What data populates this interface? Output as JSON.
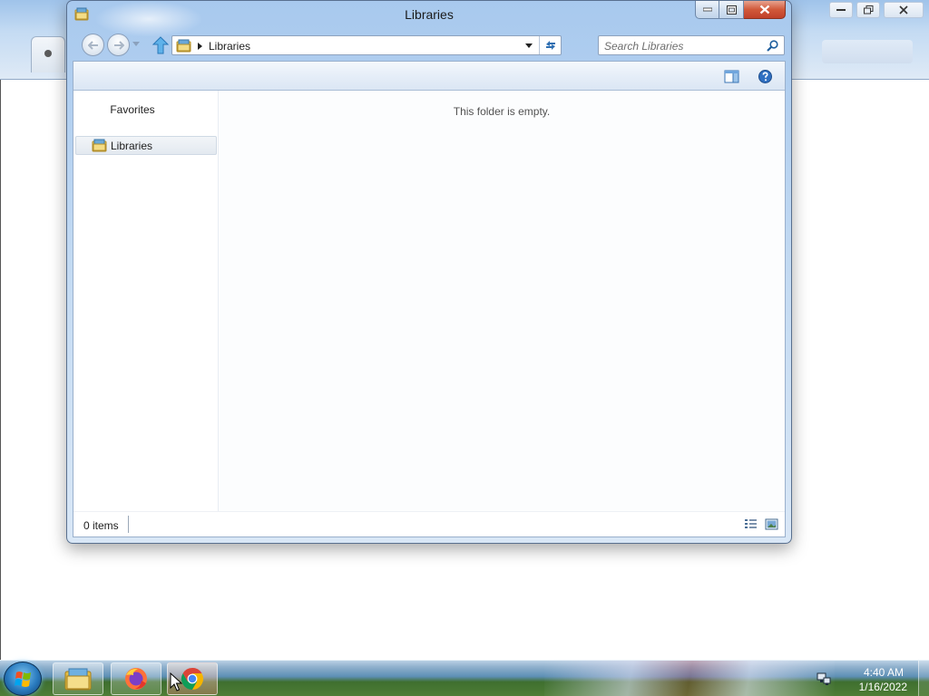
{
  "window": {
    "title": "Libraries",
    "caption": {
      "minimize": "minimize",
      "maximize": "maximize",
      "close": "close"
    }
  },
  "navigation": {
    "back_icon": "back-arrow-icon",
    "forward_icon": "forward-arrow-icon",
    "up_icon": "up-arrow-icon",
    "address": {
      "path": "Libraries",
      "icon": "libraries-folder-icon"
    },
    "refresh_icon": "refresh-icon",
    "search": {
      "placeholder": "Search Libraries",
      "value": ""
    }
  },
  "command_bar": {
    "preview_pane_icon": "preview-pane-icon",
    "help_icon": "help-icon"
  },
  "nav_pane": {
    "favorites_label": "Favorites",
    "items": [
      {
        "label": "Libraries",
        "icon": "libraries-folder-icon",
        "selected": true
      }
    ]
  },
  "content": {
    "empty_message": "This folder is empty."
  },
  "status_bar": {
    "item_count": "0 items",
    "views": [
      "details-view-icon",
      "large-icons-view-icon"
    ]
  },
  "taskbar": {
    "start_icon": "windows-start-icon",
    "pinned": [
      {
        "name": "file-explorer",
        "icon": "folder-icon"
      },
      {
        "name": "firefox",
        "icon": "firefox-icon"
      },
      {
        "name": "chrome",
        "icon": "chrome-icon",
        "active": true
      }
    ],
    "tray_icon": "network-icon",
    "clock": {
      "time": "4:40 AM",
      "date": "1/16/2022"
    }
  },
  "colors": {
    "frame": "#b7d2ef",
    "close_button": "#c7472f",
    "selection": "#e3e9f0",
    "taskbar": "#5d8fb5"
  }
}
